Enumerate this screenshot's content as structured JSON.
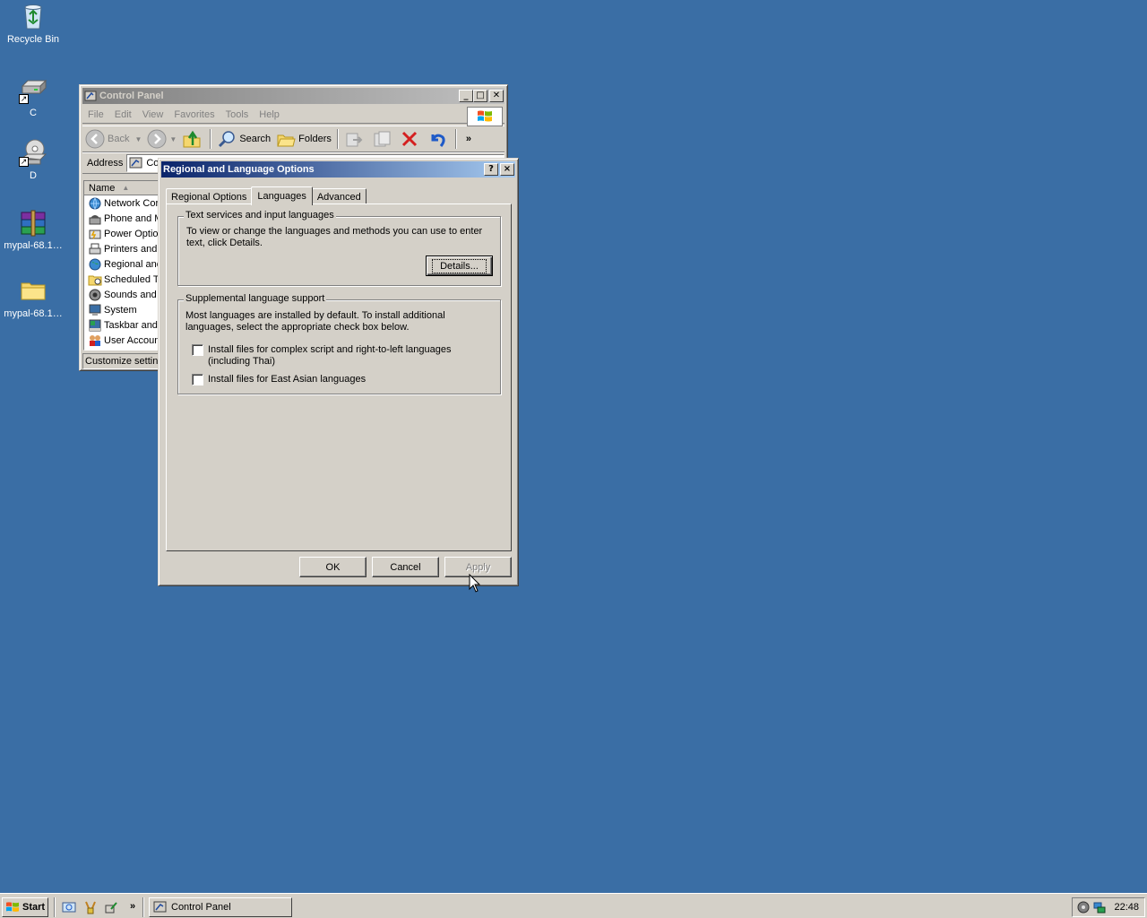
{
  "desktop": {
    "icons": [
      {
        "label": "Recycle Bin"
      },
      {
        "label": "C"
      },
      {
        "label": "D"
      },
      {
        "label": "mypal-68.1…"
      },
      {
        "label": "mypal-68.1…"
      }
    ]
  },
  "control_panel": {
    "title": "Control Panel",
    "menu": [
      "File",
      "Edit",
      "View",
      "Favorites",
      "Tools",
      "Help"
    ],
    "toolbar": {
      "back": "Back",
      "search": "Search",
      "folders": "Folders",
      "more": "»"
    },
    "address_label": "Address",
    "address_value": "Co",
    "column_name": "Name",
    "items": [
      "Network Cor",
      "Phone and M",
      "Power Optio",
      "Printers and",
      "Regional anc",
      "Scheduled T",
      "Sounds and ,",
      "System",
      "Taskbar and",
      "User Accoun"
    ],
    "status": "Customize setting"
  },
  "dialog": {
    "title": "Regional and Language Options",
    "help": "?",
    "close": "×",
    "tabs": [
      "Regional Options",
      "Languages",
      "Advanced"
    ],
    "active_tab": "Languages",
    "group_text_services": {
      "title": "Text services and input languages",
      "description": "To view or change the languages and methods you can use to enter text, click Details.",
      "details_button": "Details..."
    },
    "group_supplemental": {
      "title": "Supplemental language support",
      "description": "Most languages are installed by default. To install additional languages, select the appropriate check box below.",
      "checkbox_complex": "Install files for complex script and right-to-left languages (including Thai)",
      "checkbox_complex_checked": false,
      "checkbox_east_asian": "Install files for East Asian languages",
      "checkbox_east_asian_checked": false
    },
    "buttons": {
      "ok": "OK",
      "cancel": "Cancel",
      "apply": "Apply"
    }
  },
  "taskbar": {
    "start": "Start",
    "quick_launch_more": "»",
    "window_button": "Control Panel",
    "clock": "22:48"
  },
  "colors": {
    "desktop": "#3a6ea5",
    "face": "#d4d0c8",
    "active_title": "#0a246a",
    "inactive_title": "#808080"
  }
}
